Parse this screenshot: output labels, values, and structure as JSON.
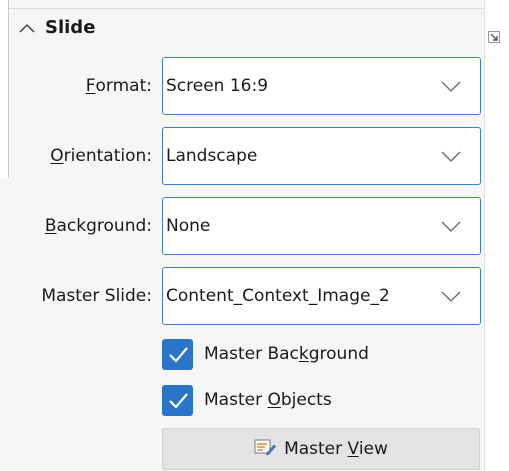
{
  "section": {
    "title": "Slide",
    "collapse_icon": "chevron-up-icon"
  },
  "fields": {
    "format": {
      "label_pre": "",
      "label_u": "F",
      "label_post": "ormat:",
      "value": "Screen 16:9"
    },
    "orientation": {
      "label_pre": "",
      "label_u": "O",
      "label_post": "rientation:",
      "value": "Landscape"
    },
    "background": {
      "label_pre": "",
      "label_u": "B",
      "label_post": "ackground:",
      "value": "None"
    },
    "master_slide": {
      "label": "Master Slide:",
      "value": "Content_Context_Image_2"
    }
  },
  "checkboxes": {
    "master_background": {
      "label_pre": "Master Bac",
      "label_u": "k",
      "label_post": "ground",
      "checked": true
    },
    "master_objects": {
      "label_pre": "Master ",
      "label_u": "O",
      "label_post": "bjects",
      "checked": true
    }
  },
  "master_view_button": {
    "label_pre": "Master ",
    "label_u": "V",
    "label_post": "iew",
    "icon": "edit-slide-icon"
  },
  "colors": {
    "accent": "#2a75c9",
    "combo_border": "#3b7fd1",
    "panel_bg": "#f6f6f6"
  }
}
